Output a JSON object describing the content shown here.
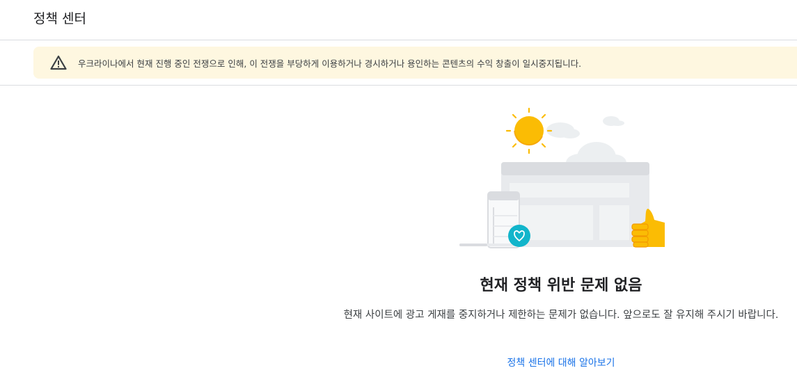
{
  "header": {
    "title": "정책 센터"
  },
  "alert": {
    "icon": "warning-icon",
    "message": "우크라이나에서 현재 진행 중인 전쟁으로 인해, 이 전쟁을 부당하게 이용하거나 경시하거나 용인하는 콘텐츠의 수익 창출이 일시중지됩니다.",
    "background": "#fef7e0"
  },
  "empty_state": {
    "title": "현재 정책 위반 문제 없음",
    "description": "현재 사이트에 광고 게재를 중지하거나 제한하는 문제가 없습니다. 앞으로도 잘 유지해 주시기 바랍니다.",
    "link_label": "정책 센터에 대해 알아보기"
  },
  "colors": {
    "link": "#1a73e8",
    "sun": "#fbbc04",
    "heart_badge": "#12b5cb"
  }
}
